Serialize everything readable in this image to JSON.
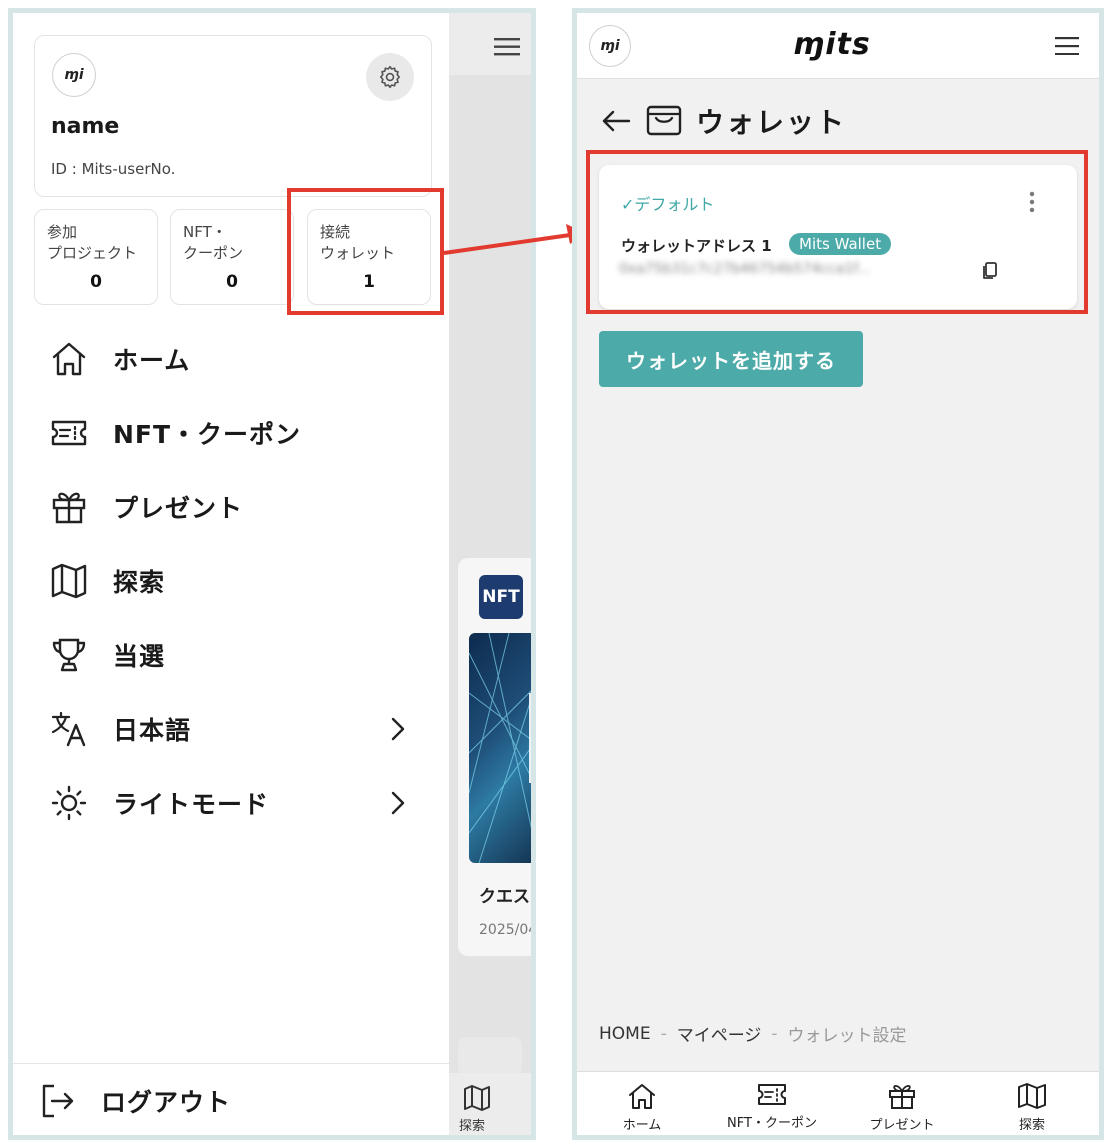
{
  "left_drawer": {
    "avatar_text": "ɱi",
    "profile_name": "name",
    "profile_id": "ID : Mits-userNo.",
    "stats": [
      {
        "label_line1": "参加",
        "label_line2": "プロジェクト",
        "value": "0"
      },
      {
        "label_line1": "NFT・",
        "label_line2": "クーポン",
        "value": "0"
      },
      {
        "label_line1": "接続",
        "label_line2": "ウォレット",
        "value": "1"
      }
    ],
    "menu": [
      {
        "label": "ホーム",
        "icon": "home-icon"
      },
      {
        "label": "NFT・クーポン",
        "icon": "ticket-icon"
      },
      {
        "label": "プレゼント",
        "icon": "gift-icon"
      },
      {
        "label": "探索",
        "icon": "map-icon"
      },
      {
        "label": "当選",
        "icon": "trophy-icon"
      },
      {
        "label": "日本語",
        "icon": "translate-icon"
      },
      {
        "label": "ライトモード",
        "icon": "sun-icon"
      }
    ],
    "logout_label": "ログアウト"
  },
  "background_app": {
    "nft_thumb_text": "NFT",
    "card_title": "クエス",
    "card_date": "2025/04",
    "tab_explore": "探索"
  },
  "right_page": {
    "avatar_text": "ɱi",
    "logo_text": "ɱits",
    "page_title": "ウォレット",
    "default_label": "✓デフォルト",
    "address_label": "ウォレットアドレス 1",
    "badge": "Mits Wallet",
    "address_value": "0xa75b31c7c27b46754b574cca1f...",
    "add_button": "ウォレットを追加する",
    "breadcrumb": [
      "HOME",
      "マイページ",
      "ウォレット設定"
    ],
    "breadcrumb_sep": "-",
    "tabs": [
      {
        "label": "ホーム",
        "icon": "home-icon"
      },
      {
        "label": "NFT・クーポン",
        "icon": "ticket-icon"
      },
      {
        "label": "プレゼント",
        "icon": "gift-icon"
      },
      {
        "label": "探索",
        "icon": "map-icon"
      }
    ]
  },
  "colors": {
    "accent_teal": "#4caaa8",
    "highlight_red": "#e23a2e",
    "frame_border": "#d6e6e6"
  }
}
